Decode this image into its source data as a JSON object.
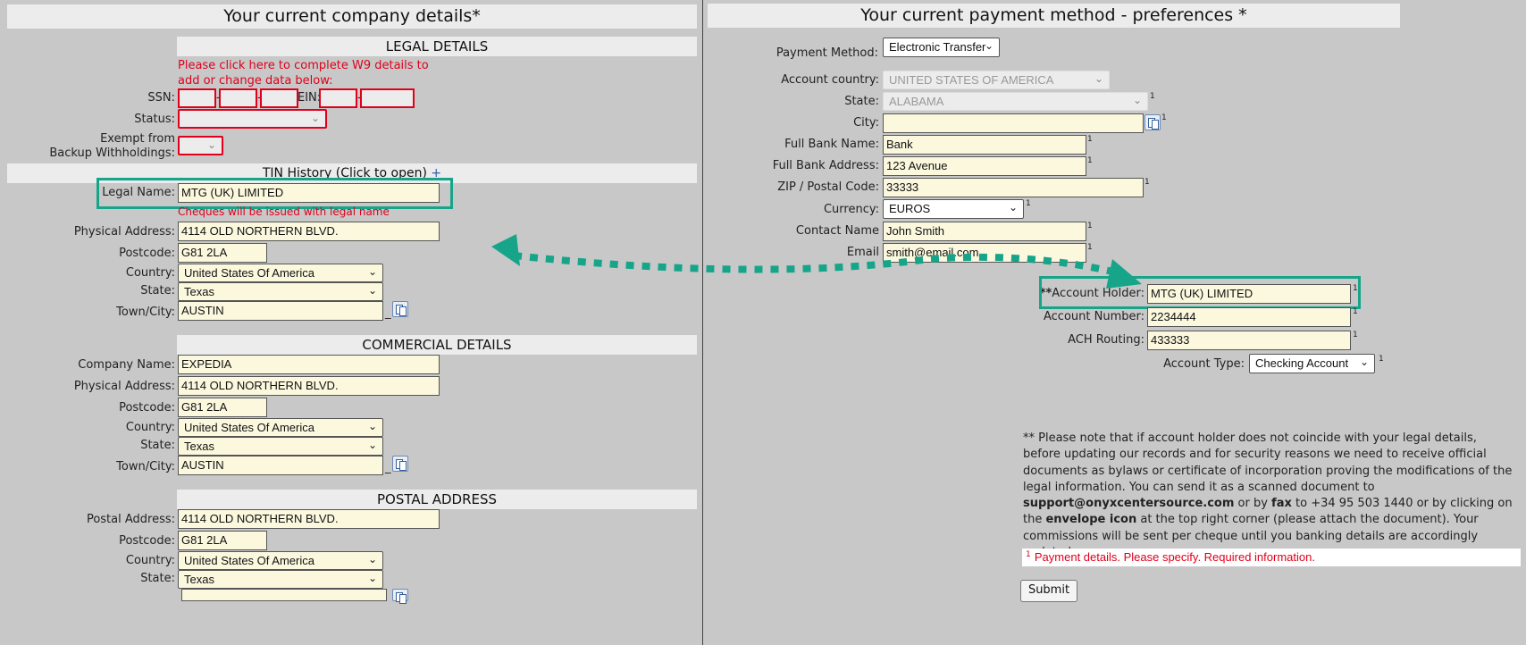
{
  "left": {
    "title": "Your current company details*",
    "legal": {
      "title": "LEGAL DETAILS",
      "w9_link_line1": "Please click here to complete W9 details to",
      "w9_link_line2": "add or change data below:",
      "ssn_label": "SSN:",
      "ein_label": "EIN:",
      "status_label": "Status:",
      "exempt_label_line1": "Exempt from",
      "exempt_label_line2": "Backup Withholdings:",
      "tin_history": "TIN History (Click to open)",
      "tin_plus": "+",
      "legal_name_label": "Legal Name:",
      "legal_name_value": "MTG (UK) LIMITED",
      "cheque_note": "Cheques will be issued with legal name",
      "physical_address_label": "Physical Address:",
      "physical_address_value": "4114 OLD NORTHERN BLVD.",
      "postcode_label": "Postcode:",
      "postcode_value": "G81 2LA",
      "country_label": "Country:",
      "country_value": "United States Of America",
      "state_label": "State:",
      "state_value": "Texas",
      "town_label": "Town/City:",
      "town_value": "AUSTIN"
    },
    "commercial": {
      "title": "COMMERCIAL DETAILS",
      "company_name_label": "Company Name:",
      "company_name_value": "EXPEDIA",
      "physical_address_label": "Physical Address:",
      "physical_address_value": "4114 OLD NORTHERN BLVD.",
      "postcode_label": "Postcode:",
      "postcode_value": "G81 2LA",
      "country_label": "Country:",
      "country_value": "United States Of America",
      "state_label": "State:",
      "state_value": "Texas",
      "town_label": "Town/City:",
      "town_value": "AUSTIN"
    },
    "postal": {
      "title": "POSTAL ADDRESS",
      "postal_address_label": "Postal Address:",
      "postal_address_value": "4114 OLD NORTHERN BLVD.",
      "postcode_label": "Postcode:",
      "postcode_value": "G81 2LA",
      "country_label": "Country:",
      "country_value": "United States Of America",
      "state_label": "State:",
      "state_value": "Texas"
    }
  },
  "right": {
    "title": "Your current payment method - preferences *",
    "payment_method_label": "Payment Method:",
    "payment_method_value": "Electronic Transfer",
    "account_country_label": "Account country:",
    "account_country_value": "UNITED STATES OF AMERICA",
    "state_label": "State:",
    "state_value": "ALABAMA",
    "city_label": "City:",
    "city_value": "",
    "bank_name_label": "Full Bank Name:",
    "bank_name_value": "Bank",
    "bank_address_label": "Full Bank Address:",
    "bank_address_value": "123 Avenue",
    "zip_label": "ZIP / Postal Code:",
    "zip_value": "33333",
    "currency_label": "Currency:",
    "currency_value": "EUROS",
    "contact_label": "Contact Name",
    "contact_value": "John Smith",
    "email_label": "Email",
    "email_value": "smith@email.com",
    "account_holder_prefix": "**",
    "account_holder_label": "Account Holder:",
    "account_holder_value": "MTG (UK) LIMITED",
    "account_number_label": "Account Number:",
    "account_number_value": "2234444",
    "ach_label": "ACH Routing:",
    "ach_value": "433333",
    "account_type_label": "Account Type:",
    "account_type_value": "Checking Account",
    "footnote_mark": "1",
    "note_part1": "** Please note that if account holder does not coincide with your legal details, before updating our records and for security reasons we need to receive official documents as bylaws or certificate of incorporation proving the modifications of the legal information. You can send it as a scanned document to ",
    "note_email": "support@onyxcentersource.com",
    "note_part2": " or by ",
    "note_fax": "fax",
    "note_part3": " to +34 95 503 1440 or by clicking on the ",
    "note_envelope": "envelope icon",
    "note_part4": " at the top right corner (please attach the document). Your commissions will be sent per cheque until you banking details are accordingly updated",
    "required_text": "Payment details. Please specify. Required information.",
    "submit_label": "Submit"
  },
  "colors": {
    "accent_highlight": "#17a58a",
    "error_red": "#e0001b",
    "field_bg": "#fbf8de"
  },
  "icons": [
    "chevron-down-icon",
    "address-book-icon",
    "dotted-double-arrow-icon"
  ]
}
